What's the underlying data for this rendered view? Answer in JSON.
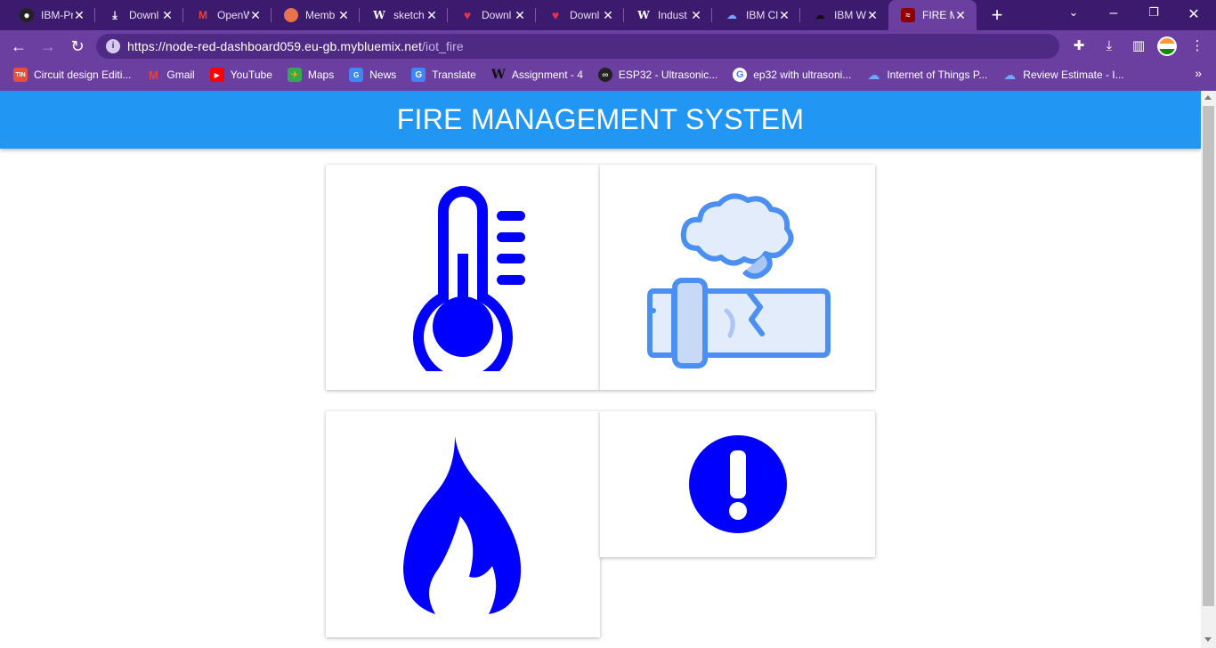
{
  "browser": {
    "tabs": [
      {
        "title": "IBM-Pr",
        "icon": "github-icon"
      },
      {
        "title": "Downl",
        "icon": "download-icon"
      },
      {
        "title": "OpenW",
        "icon": "gmail-icon"
      },
      {
        "title": "Memb",
        "icon": "avatar-icon"
      },
      {
        "title": "sketch",
        "icon": "w-logo-icon"
      },
      {
        "title": "Downl",
        "icon": "heart-icon"
      },
      {
        "title": "Downl",
        "icon": "heart-icon"
      },
      {
        "title": "Indust",
        "icon": "w-logo-icon"
      },
      {
        "title": "IBM Cl",
        "icon": "ibm-cloud-icon"
      },
      {
        "title": "IBM W",
        "icon": "ibm-watson-icon"
      },
      {
        "title": "FIRE M",
        "icon": "node-red-icon",
        "active": true
      }
    ],
    "url_host": "https://node-red-dashboard059.eu-gb.mybluemix.net",
    "url_path": "/iot_fire",
    "bookmarks": [
      {
        "label": "Circuit design Editi...",
        "icon": "tinkercad-icon"
      },
      {
        "label": "Gmail",
        "icon": "gmail-icon"
      },
      {
        "label": "YouTube",
        "icon": "youtube-icon"
      },
      {
        "label": "Maps",
        "icon": "maps-icon"
      },
      {
        "label": "News",
        "icon": "news-icon"
      },
      {
        "label": "Translate",
        "icon": "translate-icon"
      },
      {
        "label": "Assignment - 4",
        "icon": "w-logo-icon"
      },
      {
        "label": "ESP32 - Ultrasonic...",
        "icon": "esp32-icon"
      },
      {
        "label": "ep32 with ultrasoni...",
        "icon": "google-icon"
      },
      {
        "label": "Internet of Things P...",
        "icon": "ibm-cloud-icon"
      },
      {
        "label": "Review Estimate - I...",
        "icon": "ibm-cloud-icon"
      }
    ]
  },
  "dashboard": {
    "title": "FIRE MANAGEMENT SYSTEM",
    "cards": [
      {
        "name": "temperature-card",
        "icon": "thermometer-icon"
      },
      {
        "name": "gas-leak-card",
        "icon": "broken-pipe-gas-icon"
      },
      {
        "name": "flame-card",
        "icon": "flame-icon"
      },
      {
        "name": "alert-card",
        "icon": "exclamation-icon"
      }
    ]
  },
  "colors": {
    "header": "#2196f3",
    "icon_blue": "#0000ff",
    "pipe_blue": "#4b8ff2",
    "browser_frame": "#6a3fa0"
  }
}
